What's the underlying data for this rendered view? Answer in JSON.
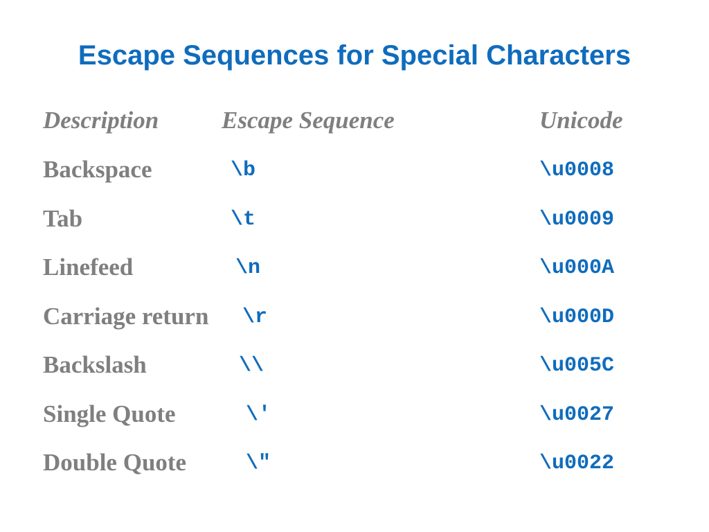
{
  "title": "Escape Sequences for Special Characters",
  "headers": {
    "description": "Description",
    "escape_sequence": "Escape Sequence",
    "unicode": "Unicode"
  },
  "rows": [
    {
      "description": "Backspace",
      "escape": "\\b",
      "unicode": "\\u0008"
    },
    {
      "description": "Tab",
      "escape": "\\t",
      "unicode": "\\u0009"
    },
    {
      "description": "Linefeed",
      "escape": "\\n",
      "unicode": "\\u000A"
    },
    {
      "description": "Carriage return",
      "escape": "\\r",
      "unicode": "\\u000D"
    },
    {
      "description": "Backslash",
      "escape": "\\\\",
      "unicode": "\\u005C"
    },
    {
      "description": "Single Quote",
      "escape": "\\′",
      "unicode": "\\u0027"
    },
    {
      "description": "Double Quote",
      "escape": "\\″",
      "unicode": "\\u0022"
    }
  ],
  "colors": {
    "accent": "#0f6cbd",
    "text_gray": "#7f7f7f"
  }
}
